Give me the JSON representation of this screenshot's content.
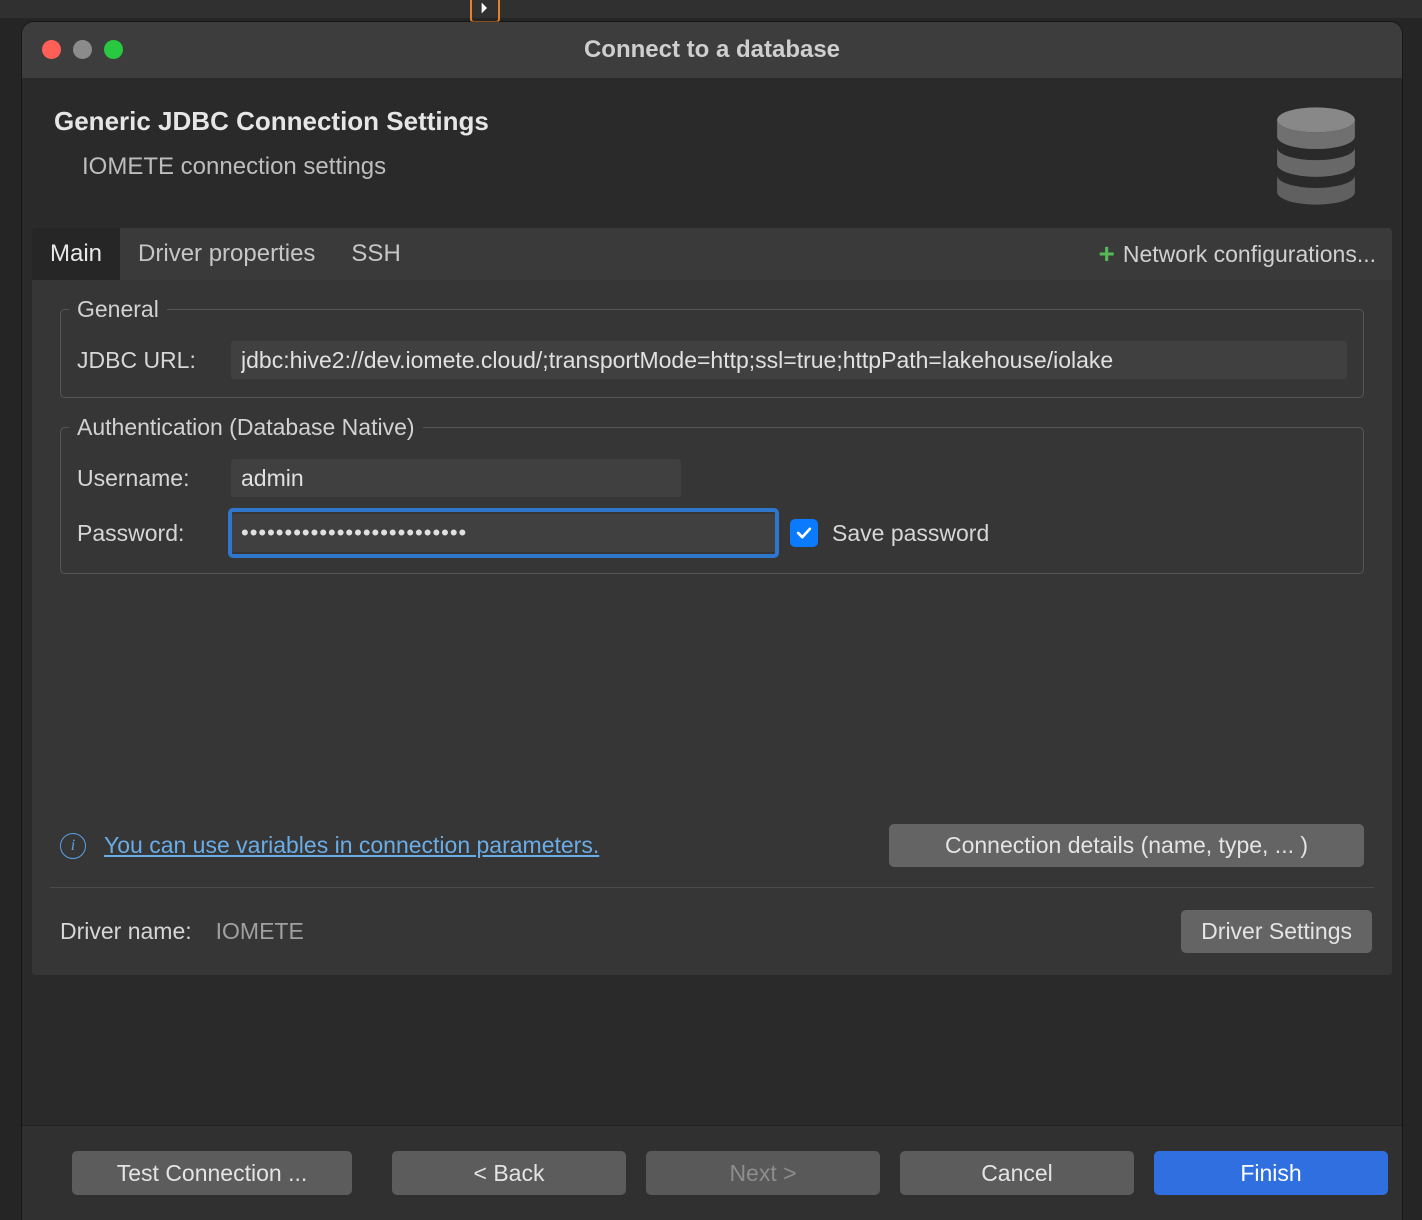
{
  "window": {
    "title": "Connect to a database"
  },
  "header": {
    "title": "Generic JDBC Connection Settings",
    "subtitle": "IOMETE connection settings"
  },
  "tabs": {
    "items": [
      {
        "label": "Main",
        "active": true
      },
      {
        "label": "Driver properties",
        "active": false
      },
      {
        "label": "SSH",
        "active": false
      }
    ],
    "network_config": "Network configurations..."
  },
  "general": {
    "legend": "General",
    "url_label": "JDBC URL:",
    "url_value": "jdbc:hive2://dev.iomete.cloud/;transportMode=http;ssl=true;httpPath=lakehouse/iolake"
  },
  "auth": {
    "legend": "Authentication (Database Native)",
    "username_label": "Username:",
    "username_value": "admin",
    "password_label": "Password:",
    "password_value": "••••••••••••••••••••••••••",
    "save_password_checked": true,
    "save_password_label": "Save password"
  },
  "info": {
    "link": "You can use variables in connection parameters.",
    "details_btn": "Connection details (name, type, ... )"
  },
  "driver": {
    "label": "Driver name:",
    "name": "IOMETE",
    "settings_btn": "Driver Settings"
  },
  "footer": {
    "test": "Test Connection ...",
    "back": "< Back",
    "next": "Next >",
    "cancel": "Cancel",
    "finish": "Finish"
  }
}
